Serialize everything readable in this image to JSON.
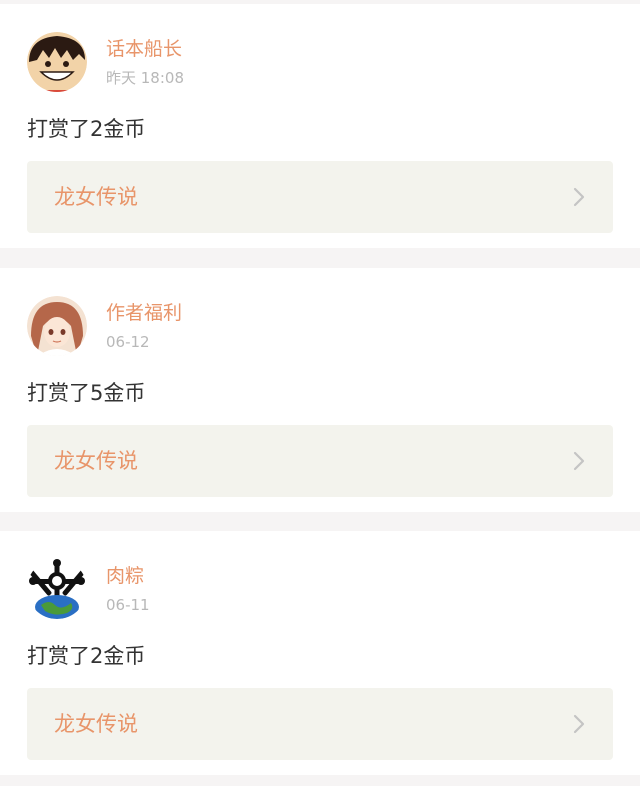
{
  "feed": {
    "items": [
      {
        "user": "话本船长",
        "time": "昨天 18:08",
        "message": "打赏了2金币",
        "book": "龙女传说",
        "avatar": "cartoon-pirate-avatar"
      },
      {
        "user": "作者福利",
        "time": "06-12",
        "message": "打赏了5金币",
        "book": "龙女传说",
        "avatar": "anime-girl-avatar"
      },
      {
        "user": "肉粽",
        "time": "06-11",
        "message": "打赏了2金币",
        "book": "龙女传说",
        "avatar": "globe-emblem-avatar"
      }
    ]
  },
  "colors": {
    "accent": "#e8956a",
    "muted_text": "#b8b8b8",
    "body_text": "#333333",
    "link_bg": "#f3f3ed",
    "page_bg": "#f6f4f4",
    "chevron": "#c4c4c4"
  },
  "icons": {
    "chevron": "chevron-right-icon"
  }
}
